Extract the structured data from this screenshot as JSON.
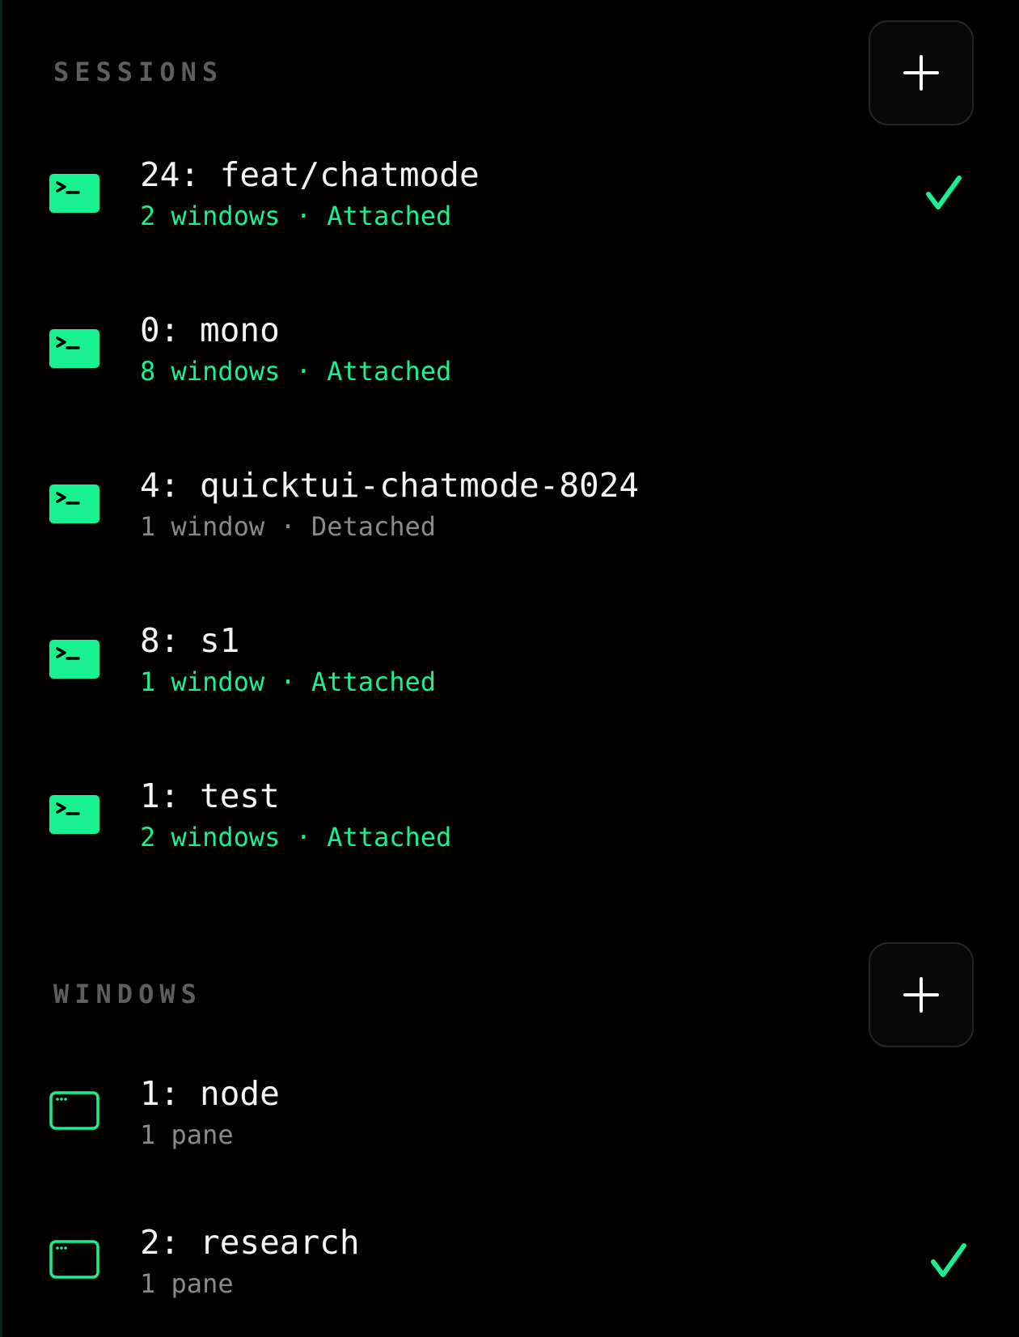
{
  "colors": {
    "accent": "#19f08f",
    "background": "#000000",
    "muted_text": "#8a8a8a",
    "header_text": "#5e5e5e"
  },
  "sessions": {
    "header": "SESSIONS",
    "add_icon": "plus-icon",
    "items": [
      {
        "title": "24: feat/chatmode",
        "subtitle": "2 windows · Attached",
        "state": "attached",
        "selected": true
      },
      {
        "title": "0: mono",
        "subtitle": "8 windows · Attached",
        "state": "attached",
        "selected": false
      },
      {
        "title": "4: quicktui-chatmode-8024",
        "subtitle": "1 window · Detached",
        "state": "detached",
        "selected": false
      },
      {
        "title": "8: s1",
        "subtitle": "1 window · Attached",
        "state": "attached",
        "selected": false
      },
      {
        "title": "1: test",
        "subtitle": "2 windows · Attached",
        "state": "attached",
        "selected": false
      }
    ]
  },
  "windows": {
    "header": "WINDOWS",
    "add_icon": "plus-icon",
    "items": [
      {
        "title": "1: node",
        "subtitle": "1 pane",
        "selected": false
      },
      {
        "title": "2: research",
        "subtitle": "1 pane",
        "selected": true
      }
    ]
  }
}
